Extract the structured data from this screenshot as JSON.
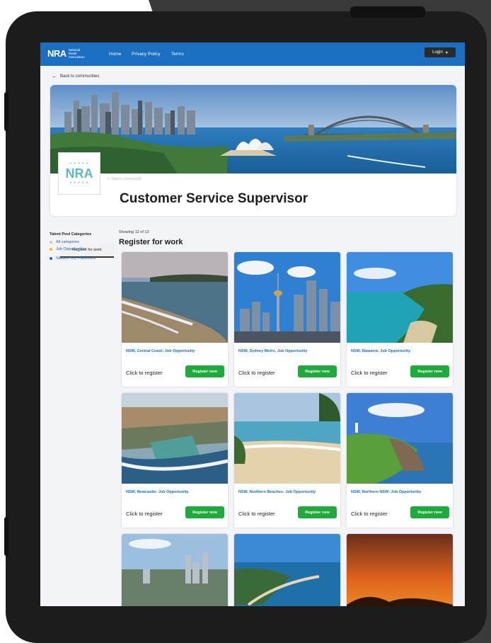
{
  "header": {
    "logo_text": "NRA",
    "logo_sub": [
      "National",
      "Retail",
      "Association"
    ],
    "nav": [
      "Home",
      "Privacy Policy",
      "Terms"
    ],
    "login_label": "Login"
  },
  "back_link": "Back to communities",
  "hero": {
    "org_logo_text": "NRA",
    "talent_link": "Talent community",
    "title": "Customer Service Supervisor",
    "tab_label": "Register for work"
  },
  "sidebar": {
    "title": "Talent Pool Categories",
    "categories": [
      {
        "label": "All categories",
        "color": "#c9c9c9"
      },
      {
        "label": "Job Opportunities",
        "color": "#f2c200"
      },
      {
        "label": "Student Job Placement",
        "color": "#2a5fd6"
      }
    ]
  },
  "listing": {
    "showing": "Showing 12 of 13",
    "title": "Register for work"
  },
  "cards": [
    {
      "location": "NSW, Central Coast: Job Opportunity",
      "click": "Click to register",
      "button": "Register now",
      "scene": "coast"
    },
    {
      "location": "NSW, Sydney Metro, Job Opportunity",
      "click": "Click to register",
      "button": "Register now",
      "scene": "city"
    },
    {
      "location": "NSW, Illawarra: Job Opportunity",
      "click": "Click to register",
      "button": "Register now",
      "scene": "cliff"
    },
    {
      "location": "NSW, Newcastle: Job Opportunity",
      "click": "Click to register",
      "button": "Register now",
      "scene": "pool"
    },
    {
      "location": "NSW, Northern Beaches: Job Opportunity",
      "click": "Click to register",
      "button": "Register now",
      "scene": "beach"
    },
    {
      "location": "NSW, Northern NSW: Job Opportunity",
      "click": "Click to register",
      "button": "Register now",
      "scene": "headland"
    },
    {
      "location": "",
      "click": "",
      "button": "",
      "scene": "town"
    },
    {
      "location": "",
      "click": "",
      "button": "",
      "scene": "bay"
    },
    {
      "location": "",
      "click": "",
      "button": "",
      "scene": "sunset"
    }
  ],
  "colors": {
    "brand_blue": "#1a6fc0",
    "button_green": "#1eaa3c",
    "device_body": "#1c1c1c"
  }
}
